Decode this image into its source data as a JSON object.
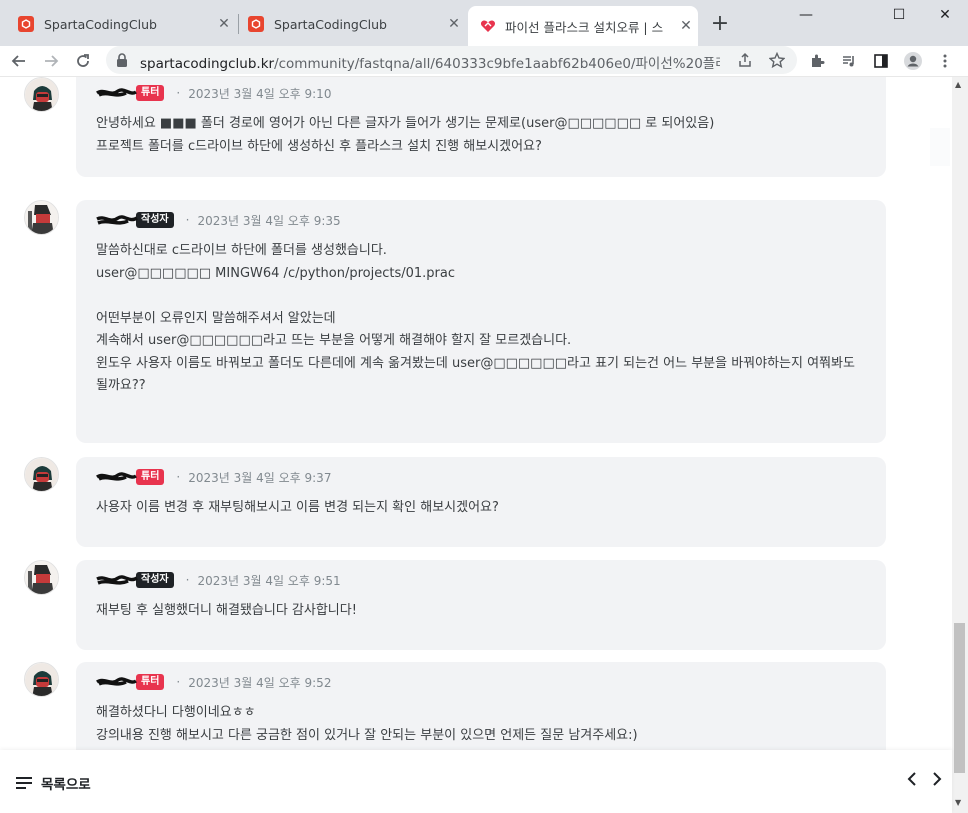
{
  "browser": {
    "tabs": [
      {
        "title": "SpartaCodingClub",
        "active": false
      },
      {
        "title": "SpartaCodingClub",
        "active": false
      },
      {
        "title": "파이선 플라스크 설치오류 | 스",
        "active": true
      }
    ],
    "new_tab_symbol": "+",
    "window_controls": {
      "minimize": "—",
      "maximize": "☐",
      "close": "✕"
    },
    "url_host": "spartacodingclub.kr",
    "url_path": "/community/fastqna/all/640333c9bfe1aabf62b406e0/파이선%20플라스...",
    "accent_color": "#e8452f"
  },
  "comments": [
    {
      "role": "tutor",
      "badge": "튜터",
      "dot": "·",
      "timestamp": "2023년 3월 4일 오후 9:10",
      "body": "안녕하세요 ■■■ 폴더 경로에 영어가 아닌 다른 글자가 들어가 생기는 문제로(user@□□□□□□ 로 되어있음)\n프로젝트 폴더를 c드라이브 하단에 생성하신 후 플라스크 설치 진행 해보시겠어요?"
    },
    {
      "role": "author",
      "badge": "작성자",
      "dot": "·",
      "timestamp": "2023년 3월 4일 오후 9:35",
      "body": "말씀하신대로 c드라이브 하단에 폴더를 생성했습니다.\nuser@□□□□□□ MINGW64 /c/python/projects/01.prac\n\n어떤부분이 오류인지 말씀해주셔서 알았는데\n계속해서 user@□□□□□□라고 뜨는 부분을 어떻게 해결해야 할지 잘 모르겠습니다.\n윈도우 사용자 이름도 바꿔보고 폴더도 다른데에 계속 옮겨봤는데 user@□□□□□□라고 표기 되는건 어느 부분을 바꿔야하는지 여쭤봐도\n될까요??"
    },
    {
      "role": "tutor",
      "badge": "튜터",
      "dot": "·",
      "timestamp": "2023년 3월 4일 오후 9:37",
      "body": "사용자 이름 변경 후 재부팅해보시고 이름 변경 되는지 확인 해보시겠어요?"
    },
    {
      "role": "author",
      "badge": "작성자",
      "dot": "·",
      "timestamp": "2023년 3월 4일 오후 9:51",
      "body": "재부팅 후 실행했더니 해결됐습니다 감사합니다!"
    },
    {
      "role": "tutor",
      "badge": "튜터",
      "dot": "·",
      "timestamp": "2023년 3월 4일 오후 9:52",
      "body": "해결하셨다니 다행이네요ㅎㅎ\n강의내용 진행 해보시고 다른 궁금한 점이 있거나 잘 안되는 부분이 있으면 언제든 질문 남겨주세요:)"
    }
  ],
  "bottom": {
    "list_label": "목록으로",
    "prev_symbol": "‹",
    "next_symbol": "›"
  },
  "colors": {
    "tutor_badge": "#e8344e",
    "author_badge": "#1f2226",
    "bubble_bg": "#f2f3f5"
  }
}
